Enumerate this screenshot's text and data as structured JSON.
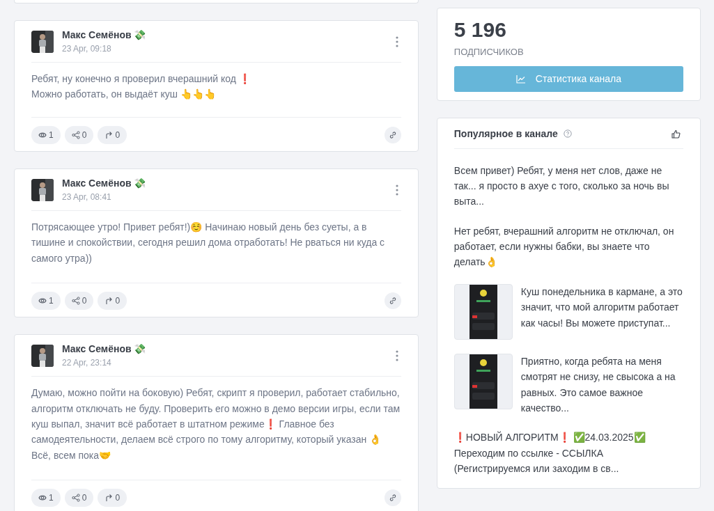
{
  "posts": [
    {
      "author": "Макс Семёнов 💸",
      "time": "23 Apr, 09:18",
      "text": "Ребят, ну конечно я проверил вчерашний код ❗\nМожно работать, он выдаёт куш 👆👆👆",
      "views": "1",
      "shares": "0",
      "forwards": "0"
    },
    {
      "author": "Макс Семёнов 💸",
      "time": "23 Apr, 08:41",
      "text": "Потрясающее утро! Привет ребят!)☺️ Начинаю новый день без суеты, а в тишине и спокойствии, сегодня решил дома отработать! Не рваться ни куда с самого утра))",
      "views": "1",
      "shares": "0",
      "forwards": "0"
    },
    {
      "author": "Макс Семёнов 💸",
      "time": "22 Apr, 23:14",
      "text": "Думаю, можно пойти на боковую) Ребят, скрипт я проверил, работает стабильно, алгоритм отключать не буду. Проверить его можно в демо версии игры, если там куш выпал, значит всё работает в штатном режиме❗ Главное без самодеятельности, делаем всё строго по тому алгоритму, который указан 👌 Всё, всем пока🤝",
      "views": "1",
      "shares": "0",
      "forwards": "0"
    }
  ],
  "stats": {
    "count": "5 196",
    "label": "ПОДПИСЧИКОВ",
    "button": "Статистика канала"
  },
  "popular": {
    "title": "Популярное в канале",
    "items": [
      {
        "kind": "text",
        "text": "Всем привет) Ребят, у меня нет слов, даже не так... я просто в ахуе с того, сколько за ночь вы выта..."
      },
      {
        "kind": "text",
        "text": "Нет ребят, вчерашний алгоритм не отключал, он работает, если нужны бабки, вы знаете что делать👌"
      },
      {
        "kind": "thumb",
        "text": "Куш понедельника в кармане, а это значит, что мой алгоритм работает как часы! Вы можете приступат..."
      },
      {
        "kind": "thumb",
        "text": "Приятно, когда ребята на меня смотрят не снизу, не свысока а на равных. Это самое важное качество..."
      },
      {
        "kind": "text",
        "text": "❗НОВЫЙ АЛГОРИТМ❗ ✅24.03.2025✅\nПереходим по ссылке - ССЫЛКА\n(Регистрируемся или заходим в св..."
      }
    ]
  }
}
